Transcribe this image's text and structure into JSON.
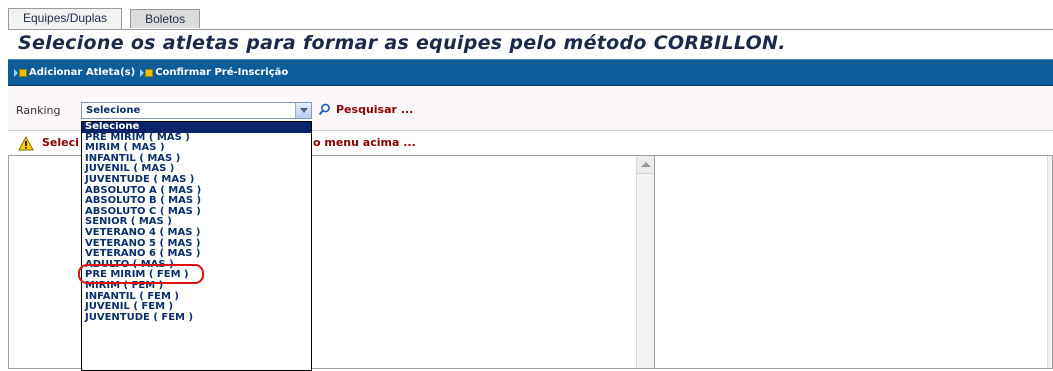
{
  "tabs": [
    {
      "label": "Equipes/Duplas",
      "active": true
    },
    {
      "label": "Boletos",
      "active": false
    }
  ],
  "page": {
    "title": "Selecione os atletas para formar as equipes pelo método CORBILLON."
  },
  "toolbar": {
    "add_label": "Adicionar Atleta(s)",
    "confirm_label": "Confirmar Pré-Inscrição"
  },
  "filter": {
    "ranking_label": "Ranking",
    "selected_value": "Selecione",
    "search_label": "Pesquisar ..."
  },
  "warning": {
    "text_left": "Seleci",
    "text_right": "o menu acima ..."
  },
  "dropdown": {
    "options": [
      "Selecione",
      "PRE MIRIM ( MAS )",
      "MIRIM ( MAS )",
      "INFANTIL ( MAS )",
      "JUVENIL ( MAS )",
      "JUVENTUDE ( MAS )",
      "ABSOLUTO A ( MAS )",
      "ABSOLUTO B ( MAS )",
      "ABSOLUTO C ( MAS )",
      "SENIOR ( MAS )",
      "VETERANO 4 ( MAS )",
      "VETERANO 5 ( MAS )",
      "VETERANO 6 ( MAS )",
      "ADULTO ( MAS )",
      "PRE MIRIM ( FEM )",
      "MIRIM ( FEM )",
      "INFANTIL ( FEM )",
      "JUVENIL ( FEM )",
      "JUVENTUDE ( FEM )"
    ],
    "highlighted_index": 0,
    "circled_option": "VETERANO 5 ( MAS )"
  },
  "colors": {
    "toolbar_bg": "#0c5d99",
    "title_color": "#1b2a4a",
    "link_red": "#8b0000",
    "annotation_red": "#e01010"
  }
}
